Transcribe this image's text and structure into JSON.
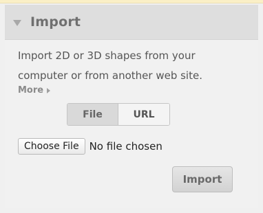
{
  "panel": {
    "title": "Import",
    "collapse_icon": "triangle-down-icon",
    "description": "Import 2D or 3D shapes from your computer or from another web site.",
    "more_label": "More",
    "more_icon": "caret-right-icon"
  },
  "source_toggle": {
    "options": [
      "File",
      "URL"
    ],
    "selected": "File"
  },
  "file_input": {
    "button_label": "Choose File",
    "status_text": "No file chosen"
  },
  "actions": {
    "import_label": "Import"
  }
}
